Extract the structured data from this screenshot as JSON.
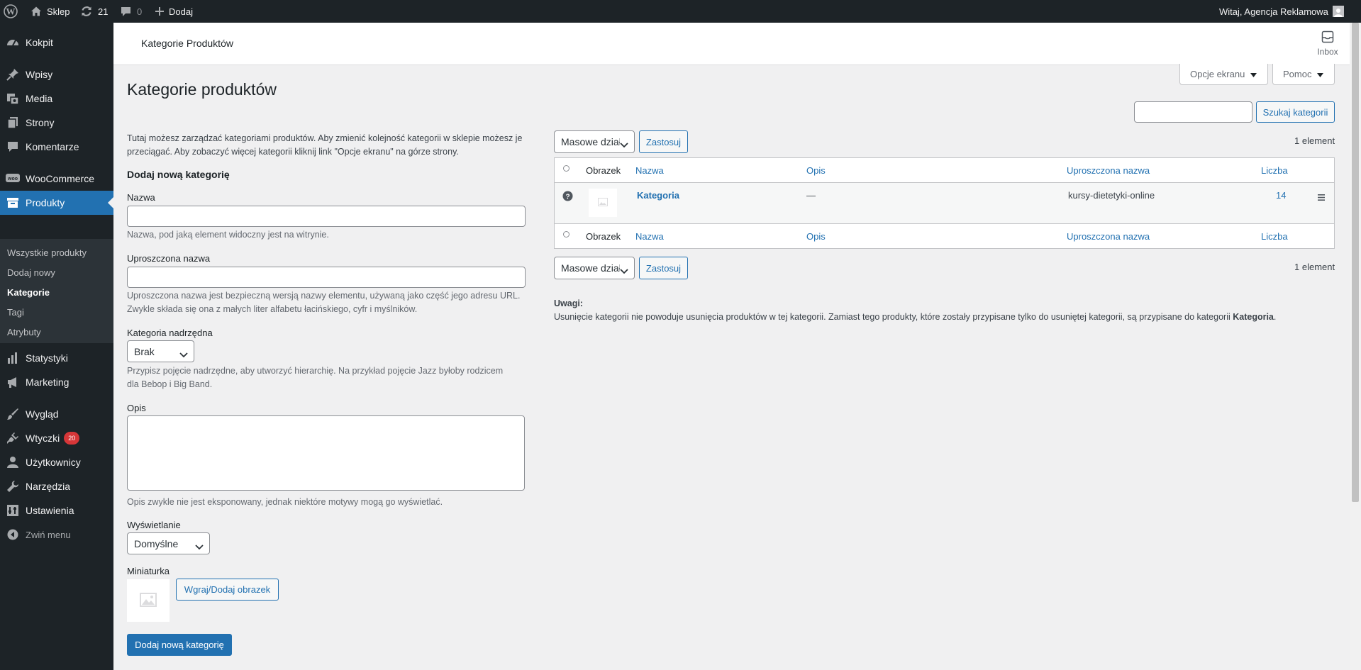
{
  "adminbar": {
    "site_name": "Sklep",
    "updates_count": "21",
    "comments_count": "0",
    "add_new_label": "Dodaj",
    "greeting": "Witaj, Agencja Reklamowa"
  },
  "sidebar": {
    "items": [
      {
        "label": "Kokpit",
        "icon": "dashboard-icon"
      },
      {
        "label": "Wpisy",
        "icon": "pin-icon"
      },
      {
        "label": "Media",
        "icon": "media-icon"
      },
      {
        "label": "Strony",
        "icon": "pages-icon"
      },
      {
        "label": "Komentarze",
        "icon": "comment-icon"
      },
      {
        "label": "WooCommerce",
        "icon": "woo-icon"
      },
      {
        "label": "Produkty",
        "icon": "archive-icon"
      },
      {
        "label": "Statystyki",
        "icon": "bar-chart-icon"
      },
      {
        "label": "Marketing",
        "icon": "megaphone-icon"
      },
      {
        "label": "Wygląd",
        "icon": "brush-icon"
      },
      {
        "label": "Wtyczki",
        "icon": "plugin-icon",
        "badge": "20"
      },
      {
        "label": "Użytkownicy",
        "icon": "user-icon"
      },
      {
        "label": "Narzędzia",
        "icon": "wrench-icon"
      },
      {
        "label": "Ustawienia",
        "icon": "settings-icon"
      },
      {
        "label": "Zwiń menu",
        "icon": "collapse-icon"
      }
    ],
    "submenu": [
      "Wszystkie produkty",
      "Dodaj nowy",
      "Kategorie",
      "Tagi",
      "Atrybuty"
    ]
  },
  "wc_header": {
    "title": "Kategorie Produktów",
    "inbox_label": "Inbox"
  },
  "screen_options_label": "Opcje ekranu",
  "help_label": "Pomoc",
  "page_title": "Kategorie produktów",
  "intro_text_1": "Tutaj możesz zarządzać kategoriami produktów. Aby zmienić kolejność kategorii w sklepie możesz je",
  "intro_text_2": "przeciągać. Aby zobaczyć więcej kategorii kliknij link \"Opcje ekranu\" na górze strony.",
  "form": {
    "heading": "Dodaj nową kategorię",
    "name_label": "Nazwa",
    "name_value": "",
    "name_desc": "Nazwa, pod jaką element widoczny jest na witrynie.",
    "slug_label": "Uproszczona nazwa",
    "slug_value": "",
    "slug_desc_1": "Uproszczona nazwa jest bezpieczną wersją nazwy elementu, używaną jako część jego adresu URL.",
    "slug_desc_2": "Zwykle składa się ona z małych liter alfabetu łacińskiego, cyfr i myślników.",
    "parent_label": "Kategoria nadrzędna",
    "parent_value": "Brak",
    "parent_desc_1": "Przypisz pojęcie nadrzędne, aby utworzyć hierarchię. Na przykład pojęcie Jazz byłoby rodzicem",
    "parent_desc_2": "dla Bebop i Big Band.",
    "desc_label": "Opis",
    "desc_value": "",
    "desc_desc": "Opis zwykle nie jest eksponowany, jednak niektóre motywy mogą go wyświetlać.",
    "display_label": "Wyświetlanie",
    "display_value": "Domyślne",
    "thumb_label": "Miniaturka",
    "upload_label": "Wgraj/Dodaj obrazek",
    "submit_label": "Dodaj nową kategorię"
  },
  "search": {
    "value": "",
    "button_label": "Szukaj kategorii"
  },
  "bulk": {
    "select_value": "Masowe działania",
    "apply_label": "Zastosuj",
    "count": "1 element"
  },
  "table": {
    "columns": {
      "image": "Obrazek",
      "name": "Nazwa",
      "description": "Opis",
      "slug": "Uproszczona nazwa",
      "count": "Liczba"
    },
    "rows": [
      {
        "name": "Kategoria",
        "description": "—",
        "slug": "kursy-dietetyki-online",
        "count": "14"
      }
    ]
  },
  "notes": {
    "heading": "Uwagi:",
    "text": "Usunięcie kategorii nie powoduje usunięcia produktów w tej kategorii. Zamiast tego produkty, które zostały przypisane tylko do usuniętej kategorii, są przypisane do kategorii ",
    "category": "Kategoria",
    "end": "."
  }
}
